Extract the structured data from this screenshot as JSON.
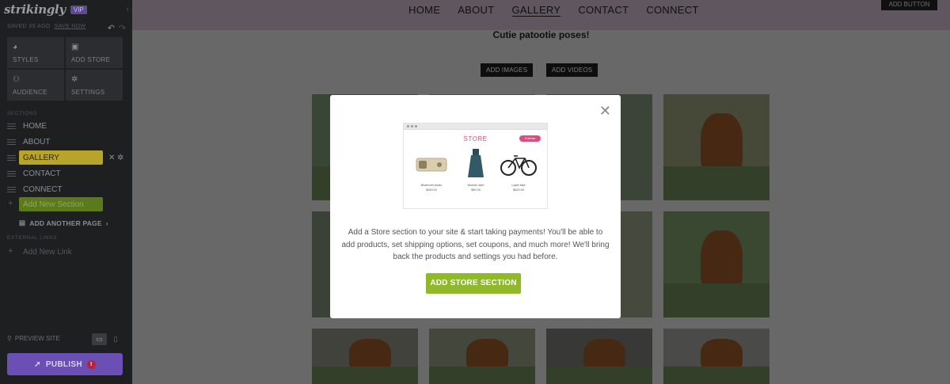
{
  "app": {
    "logo": "strikingly",
    "plan_badge": "VIP",
    "collapse_icon": "chevron-left-icon",
    "saved_text": "SAVED 3S AGO",
    "saved_link": "SAVE NOW",
    "undo_icon": "undo-icon",
    "redo_icon": "redo-icon"
  },
  "sidebar": {
    "tiles": [
      {
        "label": "STYLES",
        "icon": "palette-icon"
      },
      {
        "label": "ADD STORE",
        "icon": "store-icon"
      },
      {
        "label": "AUDIENCE",
        "icon": "people-icon"
      },
      {
        "label": "SETTINGS",
        "icon": "gear-icon"
      }
    ],
    "sections_heading": "SECTIONS",
    "sections": [
      {
        "label": "HOME"
      },
      {
        "label": "ABOUT"
      },
      {
        "label": "GALLERY",
        "active": true
      },
      {
        "label": "CONTACT"
      },
      {
        "label": "CONNECT"
      }
    ],
    "add_new_section": "Add New Section",
    "add_another_page": "ADD ANOTHER PAGE",
    "external_links_heading": "EXTERNAL LINKS",
    "add_new_link": "Add New Link",
    "preview_site": "PREVIEW SITE",
    "publish_label": "PUBLISH",
    "publish_badge": "!"
  },
  "site": {
    "nav": [
      "HOME",
      "ABOUT",
      "GALLERY",
      "CONTACT",
      "CONNECT"
    ],
    "current_nav": "GALLERY",
    "add_button": "ADD BUTTON",
    "gallery_title": "Cutie patootie poses!",
    "add_images": "ADD IMAGES",
    "add_videos": "ADD VIDEOS"
  },
  "modal": {
    "close_icon": "close-icon",
    "illustration": {
      "title": "STORE",
      "cart_label": "0 items",
      "products": [
        {
          "name": "Bluetooth Audio",
          "price": "$349.00"
        },
        {
          "name": "Women skirt",
          "price": "$59.00"
        },
        {
          "name": "Lapel bike",
          "price": "$520.00"
        }
      ]
    },
    "description": "Add a Store section to your site & start taking payments! You'll be able to add products, set shipping options, set coupons, and much more! We'll bring back the products and settings you had before.",
    "cta": "ADD STORE SECTION",
    "cta_color": "#8fb82a"
  }
}
